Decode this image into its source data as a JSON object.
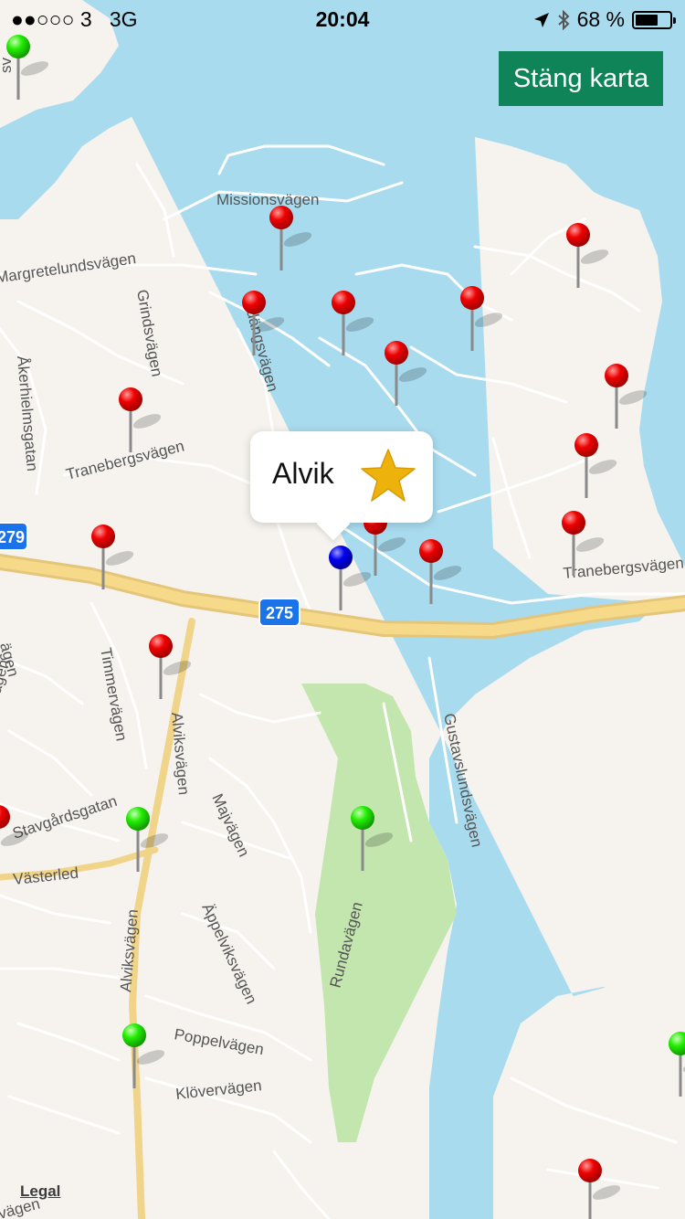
{
  "status_bar": {
    "signal": "●●○○○",
    "carrier": "3",
    "network": "3G",
    "time": "20:04",
    "battery_percent": "68 %",
    "battery_level": 0.68
  },
  "close_button": {
    "label": "Stäng karta"
  },
  "callout": {
    "title": "Alvik",
    "icon": "star-icon",
    "star_color": "#eeb20c"
  },
  "legal": "Legal",
  "colors": {
    "water": "#a9dbef",
    "land": "#f6f3ee",
    "park": "#c2e6ae",
    "road": "#ffffff",
    "highway": "#f7d98a",
    "pin_red": "#ee0000",
    "pin_green": "#22ee00",
    "pin_blue": "#0000ee",
    "shield": "#1a73e8"
  },
  "highway_shields": [
    "279",
    "275"
  ],
  "street_labels": [
    "Missionsvägen",
    "Margretelundsvägen",
    "Grindsvägen",
    "Vidängsvägen",
    "Åkerhielmsgatan",
    "Tranebergsvägen",
    "Tranebergsvägen",
    "Timmervägen",
    "Alviksvägen",
    "Gustavslundsvägen",
    "Majvägen",
    "Stavgårdsgatan",
    "Västerled",
    "Äppelviksvägen",
    "Rundavägen",
    "Alviksvägen",
    "Poppelvägen",
    "Klövervägen",
    "vägen",
    "ägen",
    "sv",
    "ägen"
  ],
  "pins": {
    "red_count": 18,
    "green_count": 5,
    "blue_count": 1
  }
}
